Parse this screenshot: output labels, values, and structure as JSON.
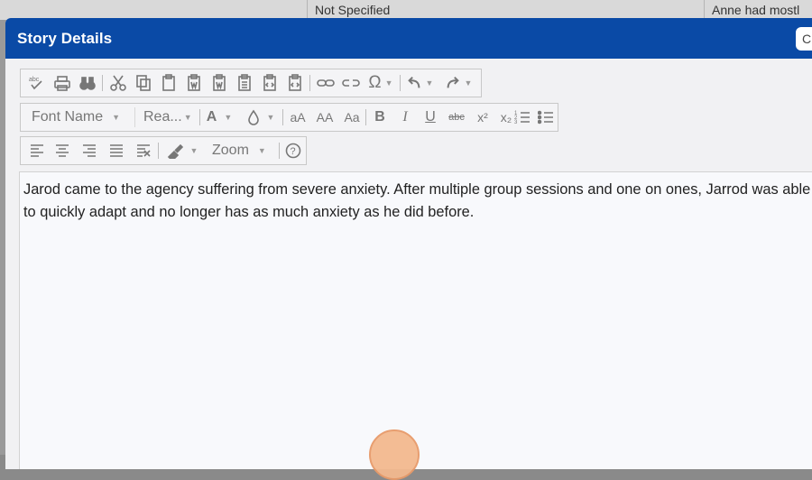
{
  "background": {
    "cell_1": "Not Specified",
    "cell_2": "Anne had mostl"
  },
  "dialog": {
    "title": "Story Details",
    "close_label": "C"
  },
  "toolbar": {
    "font_name": "Font Name",
    "font_size": "Rea...",
    "zoom": "Zoom",
    "icons": [
      "spellcheck-icon",
      "print-icon",
      "find-icon",
      "cut-icon",
      "copy-icon",
      "paste-icon",
      "paste-word-icon",
      "paste-text-icon",
      "paste-html-icon",
      "paste-plain-icon",
      "link-icon",
      "unlink-icon",
      "special-char-icon",
      "undo-icon",
      "redo-icon",
      "font-color-icon",
      "highlight-icon",
      "decrease-size-icon",
      "increase-size-icon",
      "change-case-icon",
      "bold-icon",
      "italic-icon",
      "underline-icon",
      "strikethrough-icon",
      "superscript-icon",
      "subscript-icon",
      "numbered-list-icon",
      "bulleted-list-icon",
      "align-left-icon",
      "align-center-icon",
      "align-right-icon",
      "justify-icon",
      "clear-format-icon",
      "format-painter-icon",
      "help-icon"
    ]
  },
  "toolbar_labels": {
    "font_color": "A",
    "decrease_size": "aA",
    "change_case": "Aa",
    "bold": "B",
    "italic": "I",
    "underline": "U",
    "strikethrough": "abc",
    "superscript": "x²",
    "subscript": "x₂",
    "spellcheck": "abc"
  },
  "editor": {
    "content": "Jarod came to the agency suffering from severe anxiety. After multiple group sessions and one on ones, Jarrod was able to quickly adapt and no longer has as much anxiety as he did before."
  }
}
